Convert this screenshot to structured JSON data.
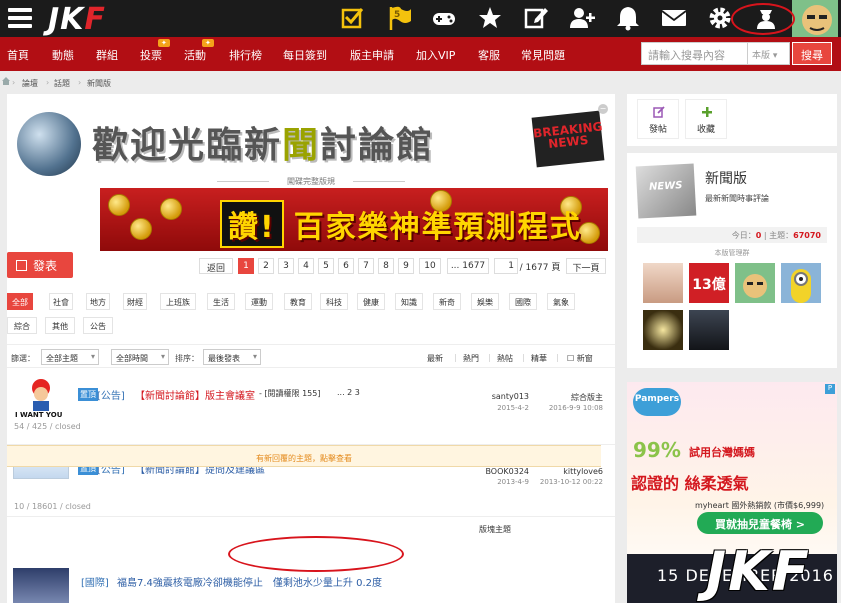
{
  "topbar": {
    "logo_a": "JK",
    "logo_b": "F",
    "badge_count": "5"
  },
  "nav": {
    "items": [
      "首頁",
      "動態",
      "群組",
      "投票",
      "活動",
      "排行榜",
      "每日簽到",
      "版主申請",
      "加入VIP",
      "客服",
      "常見問題"
    ],
    "badge_label": "✦"
  },
  "search": {
    "placeholder": "請輸入搜尋內容",
    "scope": "本版",
    "button": "搜尋"
  },
  "breadcrumb": [
    "論壇",
    "話題",
    "新聞版"
  ],
  "banner": {
    "title_a": "歡迎光臨新",
    "title_hl": "聞",
    "title_b": "討論館",
    "breaking_1": "BREAKING",
    "breaking_2": "NEWS",
    "promo_label": "闖碟完整版規",
    "promo_big": "讚!",
    "promo_text": "百家樂神準預測程式"
  },
  "toolbar": {
    "post_button": "發表",
    "pager": {
      "back": "返回",
      "pages": [
        "1",
        "2",
        "3",
        "4",
        "5",
        "6",
        "7",
        "8",
        "9",
        "10"
      ],
      "last": "... 1677",
      "current_input": "1",
      "total": "/ 1677 頁",
      "next": "下一頁"
    }
  },
  "tags": {
    "row1": [
      "全部",
      "社會",
      "地方",
      "財經",
      "上班族",
      "生活",
      "運動",
      "教育",
      "科技",
      "健康",
      "知識",
      "新奇",
      "娛樂",
      "國際",
      "氣象"
    ],
    "row2": [
      "綜合",
      "其他",
      "公告"
    ]
  },
  "filter": {
    "label": "篩選：",
    "sel1": "全部主題",
    "sel2": "全部時間",
    "sort_label": "排序：",
    "sel3": "最後發表",
    "links": [
      "最新",
      "熱門",
      "熱帖",
      "精華"
    ],
    "newwin": "新窗"
  },
  "threads": [
    {
      "tag": "置頂",
      "cat": "[公告]",
      "title": "【新聞討論館】版主會議室",
      "extra": "- [閱讀權限 155]",
      "pages": "...  2   3",
      "author": "santy013",
      "date": "2015-4-2",
      "last_author": "綜合版主",
      "last_date": "2016-9-9 10:08",
      "stats": "54 / 425 / closed",
      "thumb_text": "I WANT YOU"
    },
    {
      "tag": "置頂",
      "cat": "[公告]",
      "title": "【新聞討論館】提問及建議區",
      "author": "BOOK0324",
      "date": "2013-4-9",
      "last_author": "kittylove6",
      "last_date": "2013-10-12 00:22",
      "stats": "10 / 18601 / closed"
    },
    {
      "tag": "",
      "cat": "[國際]",
      "title": "福島7.4強震核電廠冷卻機能停止　僅剩池水少量上升 0.2度"
    }
  ],
  "sticky_label": "版塊主題",
  "new_reply_notice": "有新回覆的主題，點擊查看",
  "sidebar": {
    "post": "發帖",
    "fav": "收藏",
    "forum_thumb": "NEWS",
    "forum_name": "新聞版",
    "forum_desc": "最新新聞時事評論",
    "today_label": "今日：",
    "today_value": "0",
    "topics_label": "主題：",
    "topics_value": "67070",
    "mods_label": "本版管理群",
    "mod_text_2": "13億"
  },
  "ad": {
    "brand": "Pampers",
    "pct": "99%",
    "t1": "試用台灣媽媽",
    "t2": "認證的 絲柔透氣",
    "t3": "myheart 國外熱銷款 (市價$6,999)",
    "button": "買就抽兒童餐椅 >",
    "dec": "15 DECEMBER 2016",
    "watermark": "JKF",
    "corner": "P"
  },
  "colors": {
    "nav_red": "#b20e14",
    "accent": "#e8463e",
    "topbar": "#1b1b1b",
    "annotation": "#d8141c"
  }
}
